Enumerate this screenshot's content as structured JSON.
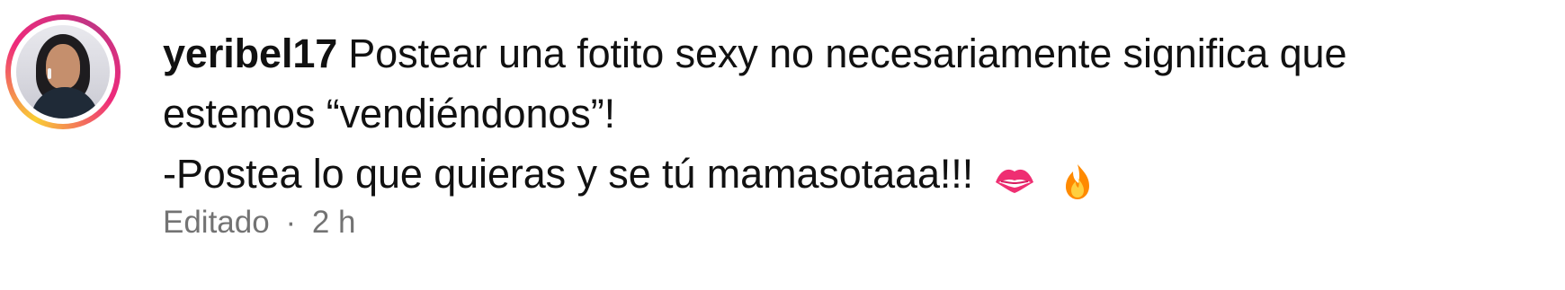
{
  "comment": {
    "username": "yeribel17",
    "text_line_1": "Postear una fotito sexy no necesariamente significa que",
    "text_line_2": "estemos “vendiéndonos”!",
    "text_line_3": "-Postea lo que quieras y se tú mamasotaaa!!!",
    "emojis": [
      "kiss-mark-icon",
      "fire-icon"
    ],
    "meta": {
      "edited_label": "Editado",
      "separator": "·",
      "time_ago": "2 h"
    }
  },
  "colors": {
    "ring_gradient": [
      "#f9ce34",
      "#ee2a7b",
      "#c13584"
    ],
    "meta_text": "#737373",
    "text": "#111111"
  }
}
